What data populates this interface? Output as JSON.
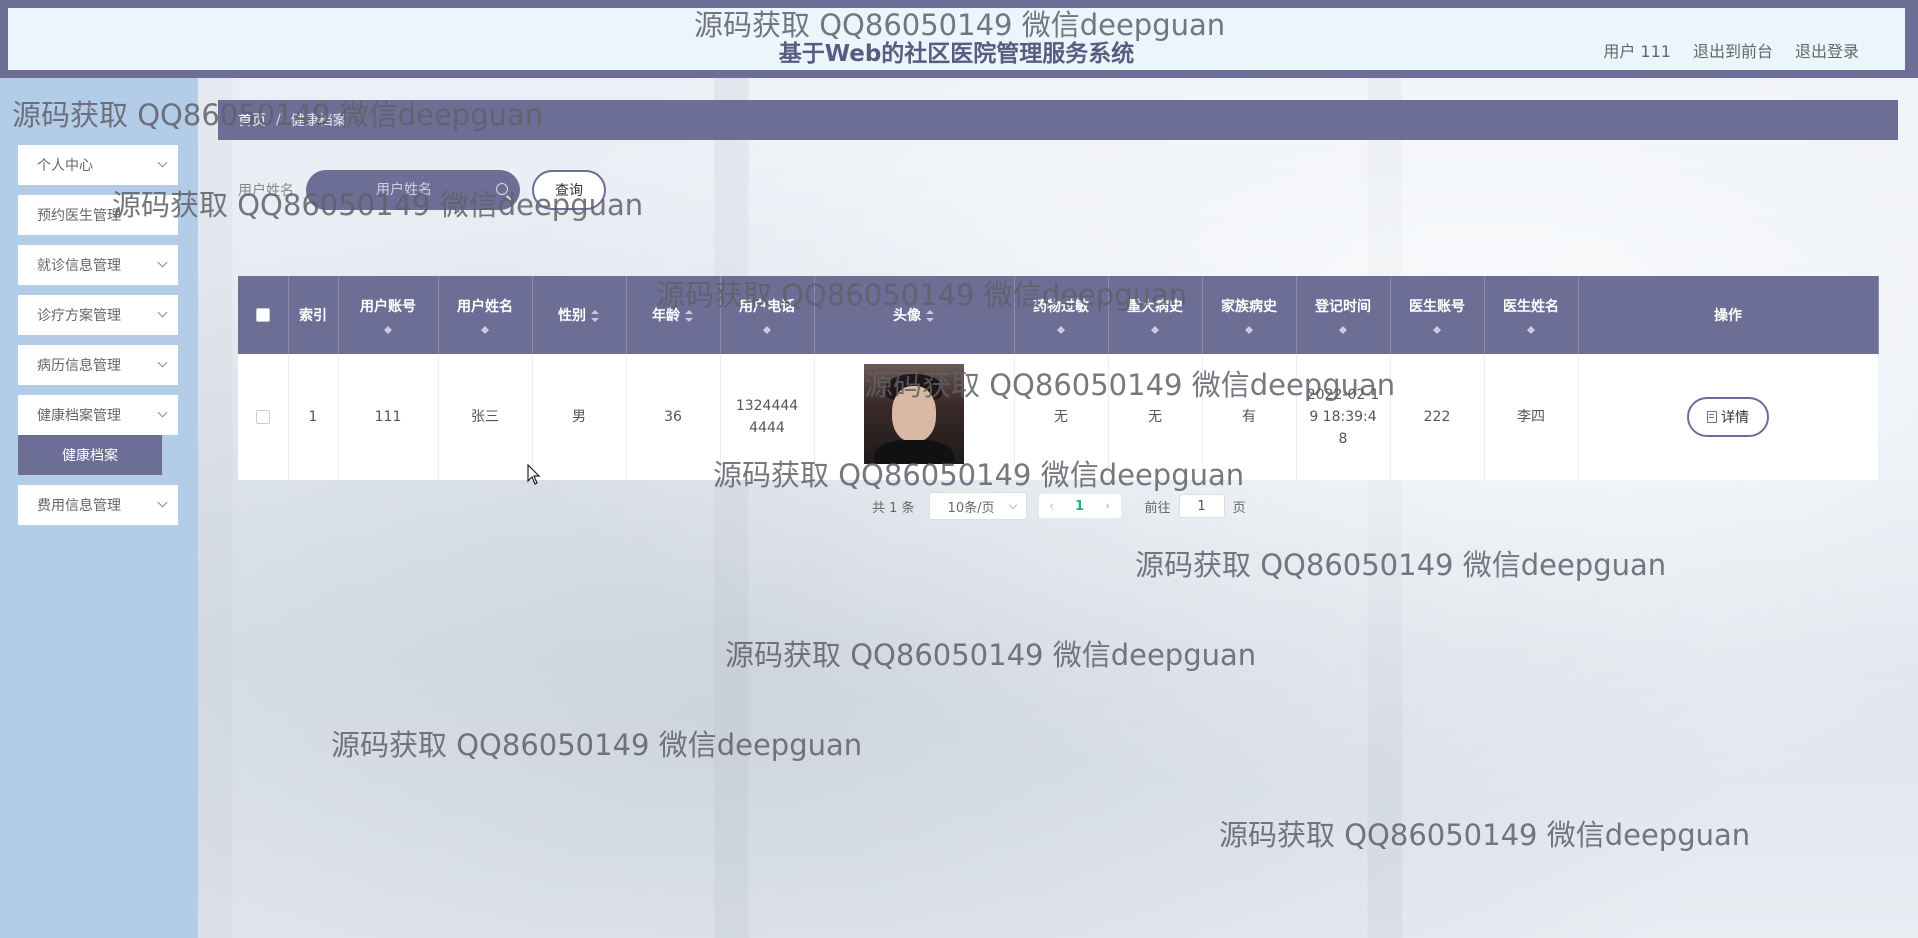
{
  "header": {
    "title": "基于Web的社区医院管理服务系统",
    "links": [
      "用户 111",
      "退出到前台",
      "退出登录"
    ]
  },
  "sidebar": {
    "items": [
      {
        "label": "个人中心",
        "has_arrow": true
      },
      {
        "label": "预约医生管理",
        "has_arrow": false
      },
      {
        "label": "就诊信息管理",
        "has_arrow": true
      },
      {
        "label": "诊疗方案管理",
        "has_arrow": true
      },
      {
        "label": "病历信息管理",
        "has_arrow": true
      },
      {
        "label": "健康档案管理",
        "has_arrow": true
      },
      {
        "label": "费用信息管理",
        "has_arrow": true
      }
    ],
    "active_sub": "健康档案"
  },
  "breadcrumb": {
    "home": "首页",
    "separator": "/",
    "current": "健康档案"
  },
  "search": {
    "label": "用户姓名",
    "placeholder": "用户姓名",
    "value": "",
    "button": "查询"
  },
  "table": {
    "columns": [
      "",
      "索引",
      "用户账号",
      "用户姓名",
      "性别",
      "年龄",
      "用户电话",
      "头像",
      "药物过敏",
      "重大病史",
      "家族病史",
      "登记时间",
      "医生账号",
      "医生姓名",
      "操作"
    ],
    "rows": [
      {
        "index": "1",
        "account": "111",
        "name": "张三",
        "gender": "男",
        "age": "36",
        "phone": "13244444444",
        "allergy": "无",
        "major_history": "无",
        "family_history": "有",
        "register_time": "2022-02-19 18:39:48",
        "doctor_account": "222",
        "doctor_name": "李四",
        "action": "详情"
      }
    ]
  },
  "pagination": {
    "total": "共 1 条",
    "page_size": "10条/页",
    "current_page": "1",
    "goto_prefix": "前往",
    "goto_value": "1",
    "goto_suffix": "页"
  },
  "watermark": "源码获取 QQ86050149 微信deepguan",
  "colors": {
    "accent": "#6d6e95",
    "sidebar_bg": "#b3cde9",
    "header_bg": "#eaf6fc",
    "page_active": "#2cae87"
  }
}
